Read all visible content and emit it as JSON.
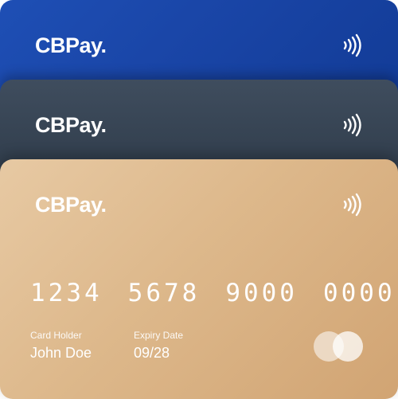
{
  "cards": [
    {
      "brand": "CBPay.",
      "color": "#1a46a8"
    },
    {
      "brand": "CBPay.",
      "color": "#33404f"
    },
    {
      "brand": "CBPay.",
      "color": "#ddb88b",
      "number_groups": [
        "1234",
        "5678",
        "9000",
        "0000"
      ],
      "holder_label": "Card Holder",
      "holder_name": "John Doe",
      "expiry_label": "Expiry Date",
      "expiry_value": "09/28"
    }
  ],
  "icons": {
    "contactless": "contactless-icon",
    "card_network": "mastercard-icon"
  }
}
